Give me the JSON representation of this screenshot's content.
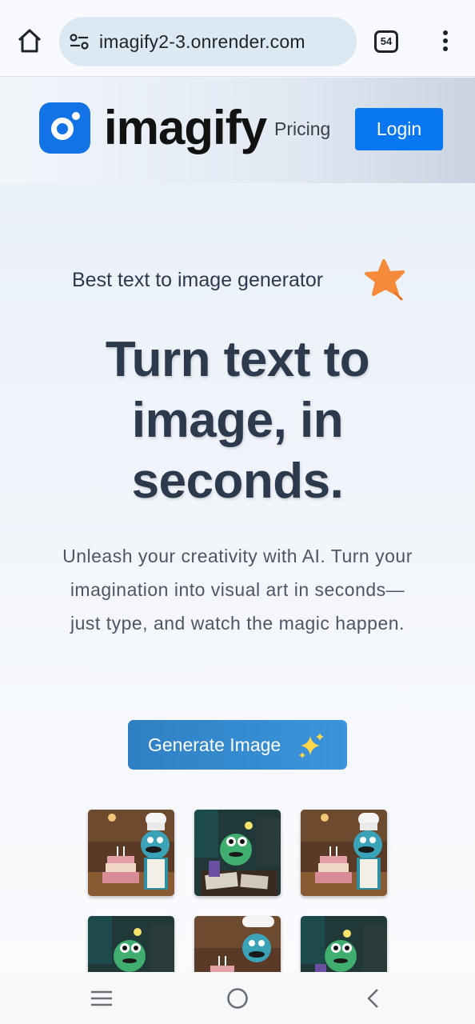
{
  "browser": {
    "url": "imagify2-3.onrender.com",
    "tab_count": "54",
    "icons": [
      "home-icon",
      "site-settings-icon",
      "tabs-icon",
      "more-vert-icon"
    ]
  },
  "nav": {
    "logo_text": "imagify",
    "pricing_label": "Pricing",
    "login_label": "Login"
  },
  "hero": {
    "tagline": "Best text to image generator",
    "headline_lines": [
      "Turn text to",
      "image, in",
      "seconds."
    ],
    "subtext_lines": [
      "Unleash your creativity with AI. Turn your",
      "imagination into visual art in seconds—",
      "just type, and watch the magic happen."
    ],
    "cta_label": "Generate Image"
  },
  "gallery": {
    "items": [
      "chef-monster-cake",
      "monster-desk",
      "chef-monster-cake",
      "monster-desk",
      "chef-monster-cake",
      "monster-desk"
    ]
  },
  "colors": {
    "brand_blue": "#1273e6",
    "login_blue": "#0a77f2",
    "cta_blue": "#2f80c2",
    "heading": "#2d3a4d",
    "star_orange": "#f58a3b"
  },
  "system_nav": {
    "icons": [
      "recents-icon",
      "home-circle-icon",
      "back-icon"
    ]
  }
}
